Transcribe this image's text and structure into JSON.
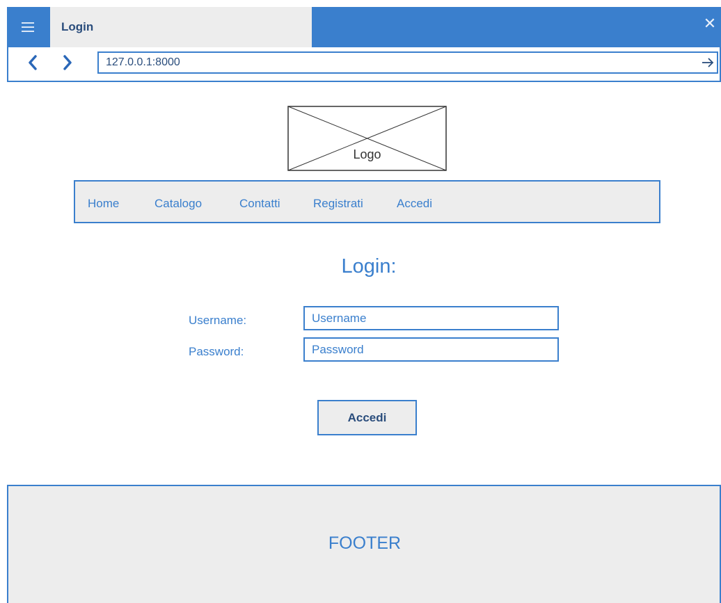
{
  "browser": {
    "tab_title": "Login",
    "url": "127.0.0.1:8000",
    "icons": {
      "menu": "hamburger-icon",
      "close": "close-icon",
      "back": "chevron-left-icon",
      "forward": "chevron-right-icon",
      "go": "arrow-right-icon"
    }
  },
  "header": {
    "logo_label": "Logo"
  },
  "nav": {
    "items": [
      {
        "label": "Home"
      },
      {
        "label": "Catalogo"
      },
      {
        "label": "Contatti"
      },
      {
        "label": "Registrati"
      },
      {
        "label": "Accedi"
      }
    ]
  },
  "login": {
    "title": "Login:",
    "username_label": "Username:",
    "username_placeholder": "Username",
    "password_label": "Password:",
    "password_placeholder": "Password",
    "submit_label": "Accedi"
  },
  "footer": {
    "text": "FOOTER"
  },
  "colors": {
    "accent": "#3a7fcd",
    "chrome_bg": "#ededed",
    "text_dark": "#2a4d7c"
  }
}
